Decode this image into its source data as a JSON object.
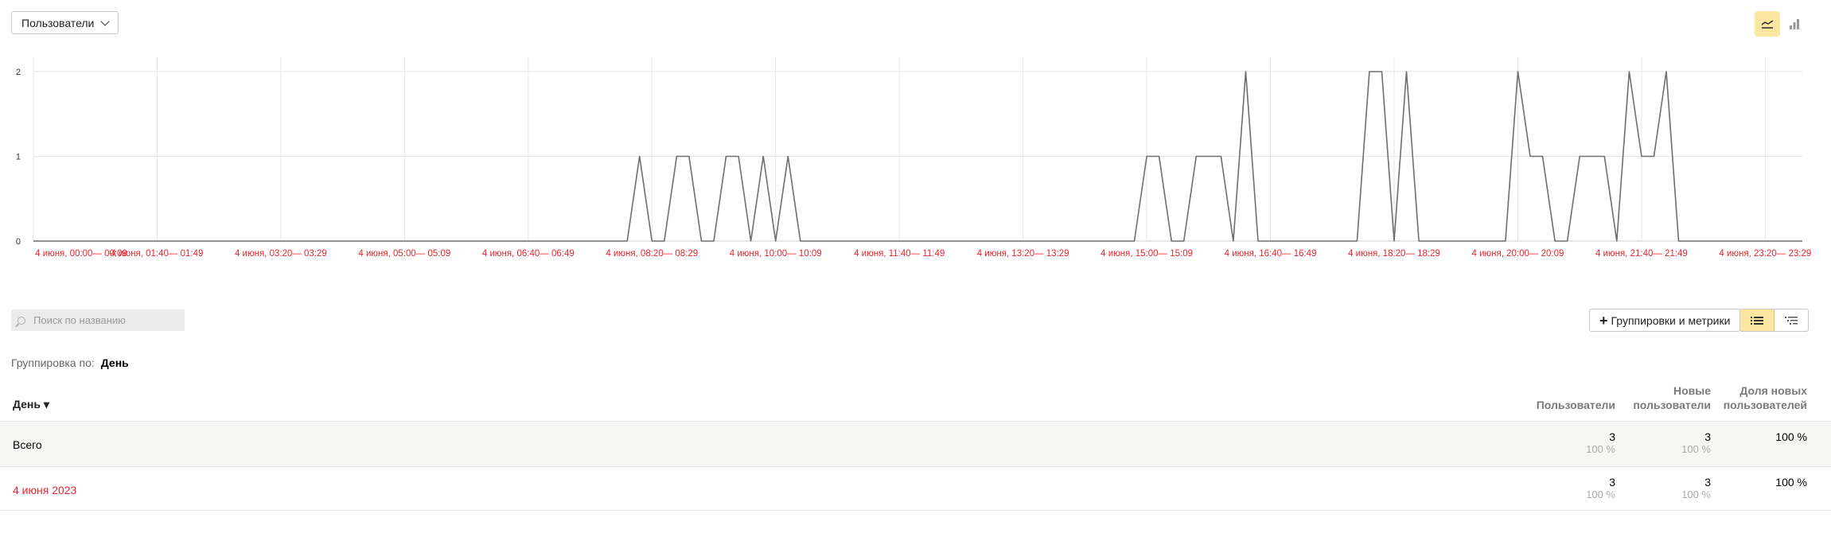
{
  "metric_selector": {
    "label": "Пользователи",
    "icon": "chevron-down-icon"
  },
  "chart_type_buttons": [
    {
      "name": "line-chart-icon",
      "active": true
    },
    {
      "name": "bar-chart-icon",
      "active": false
    }
  ],
  "colors": {
    "line": "#6e6e6e",
    "grid": "#e6e6e6",
    "x_tick": "#e8262f",
    "accent": "#fde6a0"
  },
  "chart_data": {
    "type": "line",
    "ylim": [
      0,
      2
    ],
    "yticks": [
      0,
      1,
      2
    ],
    "grid": true,
    "xtick_labels": [
      "4 июня, 00:00— 00:09",
      "4 июня, 01:40— 01:49",
      "4 июня, 03:20— 03:29",
      "4 июня, 05:00— 05:09",
      "4 июня, 06:40— 06:49",
      "4 июня, 08:20— 08:29",
      "4 июня, 10:00— 10:09",
      "4 июня, 11:40— 11:49",
      "4 июня, 13:20— 13:29",
      "4 июня, 15:00— 15:09",
      "4 июня, 16:40— 16:49",
      "4 июня, 18:20— 18:29",
      "4 июня, 20:00— 20:09",
      "4 июня, 21:40— 21:49",
      "4 июня, 23:20— 23:29"
    ],
    "series": [
      {
        "values": [
          0,
          0,
          0,
          0,
          0,
          0,
          0,
          0,
          0,
          0,
          0,
          0,
          0,
          0,
          0,
          0,
          0,
          0,
          0,
          0,
          0,
          0,
          0,
          0,
          0,
          0,
          0,
          0,
          0,
          0,
          0,
          0,
          0,
          0,
          0,
          0,
          0,
          0,
          0,
          0,
          0,
          0,
          0,
          0,
          0,
          0,
          0,
          0,
          0,
          1,
          0,
          0,
          1,
          1,
          0,
          0,
          1,
          1,
          0,
          1,
          0,
          1,
          0,
          0,
          0,
          0,
          0,
          0,
          0,
          0,
          0,
          0,
          0,
          0,
          0,
          0,
          0,
          0,
          0,
          0,
          0,
          0,
          0,
          0,
          0,
          0,
          0,
          0,
          0,
          0,
          1,
          1,
          0,
          0,
          1,
          1,
          1,
          0,
          2,
          0,
          0,
          0,
          0,
          0,
          0,
          0,
          0,
          0,
          2,
          2,
          0,
          2,
          0,
          0,
          0,
          0,
          0,
          0,
          0,
          0,
          2,
          1,
          1,
          0,
          0,
          1,
          1,
          1,
          0,
          2,
          1,
          1,
          2,
          0,
          0,
          0,
          0,
          0,
          0,
          0,
          0,
          0,
          0,
          0
        ]
      }
    ]
  },
  "search": {
    "placeholder": "Поиск по названию",
    "icon": "search-icon"
  },
  "groups_button": {
    "label": "Группировки и метрики"
  },
  "view_toggle": [
    {
      "name": "list-view-icon",
      "active": true
    },
    {
      "name": "tree-view-icon",
      "active": false
    }
  ],
  "grouping": {
    "label": "Группировка по:",
    "value": "День"
  },
  "table": {
    "dimension_header": "День ▾",
    "columns": [
      {
        "line1": "",
        "line2": "Пользователи"
      },
      {
        "line1": "Новые",
        "line2": "пользователи"
      },
      {
        "line1": "Доля новых",
        "line2": "пользователей"
      }
    ],
    "total_row": {
      "label": "Всего",
      "cells": [
        {
          "value": "3",
          "pct": "100 %"
        },
        {
          "value": "3",
          "pct": "100 %"
        },
        {
          "value": "100 %",
          "pct": ""
        }
      ]
    },
    "rows": [
      {
        "label": "4 июня 2023",
        "cells": [
          {
            "value": "3",
            "pct": "100 %"
          },
          {
            "value": "3",
            "pct": "100 %"
          },
          {
            "value": "100 %",
            "pct": ""
          }
        ]
      }
    ]
  }
}
